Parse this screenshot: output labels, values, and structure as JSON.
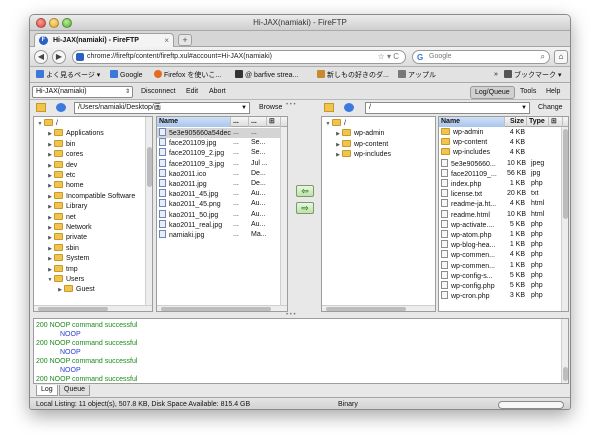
{
  "window": {
    "title": "Hi-JAX(namiaki) - FireFTP"
  },
  "tab": {
    "label": "Hi-JAX(namiaki) - FireFTP",
    "close": "×",
    "new_tab": "+"
  },
  "nav": {
    "back": "◀",
    "forward": "▶",
    "url": "chrome://fireftp/content/fireftp.xul#account=Hi-JAX(namiaki)",
    "url_right": "☆ ▾ C",
    "search_placeholder": "Google",
    "search_engine_icon": "google-icon",
    "home": "⌂"
  },
  "bookmarks": {
    "items": [
      {
        "label": "よく見るページ ▾",
        "color": "#3c78d8"
      },
      {
        "label": "Google",
        "color": "#3c78d8"
      },
      {
        "label": "Firefox を使いこ...",
        "color": "#e76a1e"
      },
      {
        "label": "@ barfive strea...",
        "color": "#333333"
      },
      {
        "label": "新しもの好きのダ...",
        "color": "#c98a2e"
      },
      {
        "label": "アップル",
        "color": "#777777"
      }
    ],
    "overflow": "»",
    "bookmark_menu": "ブックマーク ▾"
  },
  "ftp_toolbar": {
    "account": "Hi-JAX(namiaki)",
    "disconnect": "Disconnect",
    "edit": "Edit",
    "abort": "Abort",
    "log_queue": "Log/Queue",
    "tools": "Tools",
    "help": "Help"
  },
  "local": {
    "path": "/Users/namiaki/Desktop/画",
    "browse": "Browse",
    "tree": [
      {
        "label": "/",
        "level": 0,
        "open": true
      },
      {
        "label": "Applications",
        "level": 1
      },
      {
        "label": "bin",
        "level": 1
      },
      {
        "label": "cores",
        "level": 1
      },
      {
        "label": "dev",
        "level": 1
      },
      {
        "label": "etc",
        "level": 1
      },
      {
        "label": "home",
        "level": 1
      },
      {
        "label": "Incompatible Software",
        "level": 1
      },
      {
        "label": "Library",
        "level": 1
      },
      {
        "label": "net",
        "level": 1
      },
      {
        "label": "Network",
        "level": 1
      },
      {
        "label": "private",
        "level": 1
      },
      {
        "label": "sbin",
        "level": 1
      },
      {
        "label": "System",
        "level": 1
      },
      {
        "label": "tmp",
        "level": 1
      },
      {
        "label": "Users",
        "level": 1,
        "open": true
      },
      {
        "label": "Guest",
        "level": 2
      }
    ],
    "columns": [
      "Name",
      "...",
      "...",
      ""
    ],
    "files": [
      {
        "name": "5e3e905660a54deca12...",
        "c2": "...",
        "c3": "...",
        "c4": "...",
        "selected": true
      },
      {
        "name": "face201109.jpg",
        "c2": "...",
        "c3": "Se...",
        "c4": ""
      },
      {
        "name": "face201109_2.jpg",
        "c2": "...",
        "c3": "Se...",
        "c4": ""
      },
      {
        "name": "face201109_3.jpg",
        "c2": "...",
        "c3": "Jul ...",
        "c4": ""
      },
      {
        "name": "kao2011.ico",
        "c2": "...",
        "c3": "De...",
        "c4": ""
      },
      {
        "name": "kao2011.jpg",
        "c2": "...",
        "c3": "De...",
        "c4": ""
      },
      {
        "name": "kao2011_45.jpg",
        "c2": "...",
        "c3": "Au...",
        "c4": ""
      },
      {
        "name": "kao2011_45.png",
        "c2": "...",
        "c3": "Au...",
        "c4": ""
      },
      {
        "name": "kao2011_50.jpg",
        "c2": "...",
        "c3": "Au...",
        "c4": ""
      },
      {
        "name": "kao2011_real.jpg",
        "c2": "...",
        "c3": "Au...",
        "c4": ""
      },
      {
        "name": "namiaki.jpg",
        "c2": "...",
        "c3": "Ma...",
        "c4": ""
      }
    ]
  },
  "transfer": {
    "download": "⇦",
    "upload": "⇨"
  },
  "remote": {
    "path": "/",
    "change": "Change",
    "tree": [
      {
        "label": "/",
        "level": 0,
        "open": true
      },
      {
        "label": "wp-admin",
        "level": 1
      },
      {
        "label": "wp-content",
        "level": 1
      },
      {
        "label": "wp-includes",
        "level": 1
      }
    ],
    "columns": [
      "Name",
      "Size",
      "Type",
      ""
    ],
    "files": [
      {
        "name": "wp-admin",
        "size": "4 KB",
        "type": "",
        "folder": true
      },
      {
        "name": "wp-content",
        "size": "4 KB",
        "type": "",
        "folder": true
      },
      {
        "name": "wp-includes",
        "size": "4 KB",
        "type": "",
        "folder": true
      },
      {
        "name": "5e3e905660...",
        "size": "10 KB",
        "type": "jpeg"
      },
      {
        "name": "face201109_...",
        "size": "56 KB",
        "type": "jpg"
      },
      {
        "name": "index.php",
        "size": "1 KB",
        "type": "php"
      },
      {
        "name": "license.txt",
        "size": "20 KB",
        "type": "txt"
      },
      {
        "name": "readme-ja.ht...",
        "size": "4 KB",
        "type": "html"
      },
      {
        "name": "readme.html",
        "size": "10 KB",
        "type": "html"
      },
      {
        "name": "wp-activate....",
        "size": "5 KB",
        "type": "php"
      },
      {
        "name": "wp-atom.php",
        "size": "1 KB",
        "type": "php"
      },
      {
        "name": "wp-blog-hea...",
        "size": "1 KB",
        "type": "php"
      },
      {
        "name": "wp-commen...",
        "size": "4 KB",
        "type": "php"
      },
      {
        "name": "wp-commen...",
        "size": "1 KB",
        "type": "php"
      },
      {
        "name": "wp-config-s...",
        "size": "5 KB",
        "type": "php"
      },
      {
        "name": "wp-config.php",
        "size": "5 KB",
        "type": "php"
      },
      {
        "name": "wp-cron.php",
        "size": "3 KB",
        "type": "php"
      }
    ]
  },
  "log": {
    "lines": [
      {
        "text": "200 NOOP command successful",
        "kind": "resp"
      },
      {
        "text": "NOOP",
        "kind": "cmd"
      },
      {
        "text": "200 NOOP command successful",
        "kind": "resp"
      },
      {
        "text": "NOOP",
        "kind": "cmd"
      },
      {
        "text": "200 NOOP command successful",
        "kind": "resp"
      },
      {
        "text": "NOOP",
        "kind": "cmd"
      },
      {
        "text": "200 NOOP command successful",
        "kind": "resp"
      }
    ],
    "tabs": [
      "Log",
      "Queue"
    ]
  },
  "status": {
    "local_listing": "Local Listing: 11 object(s), 507.8 KB, Disk Space Available: 815.4 GB",
    "mode": "Binary",
    "progress_fraction": 0.0
  }
}
